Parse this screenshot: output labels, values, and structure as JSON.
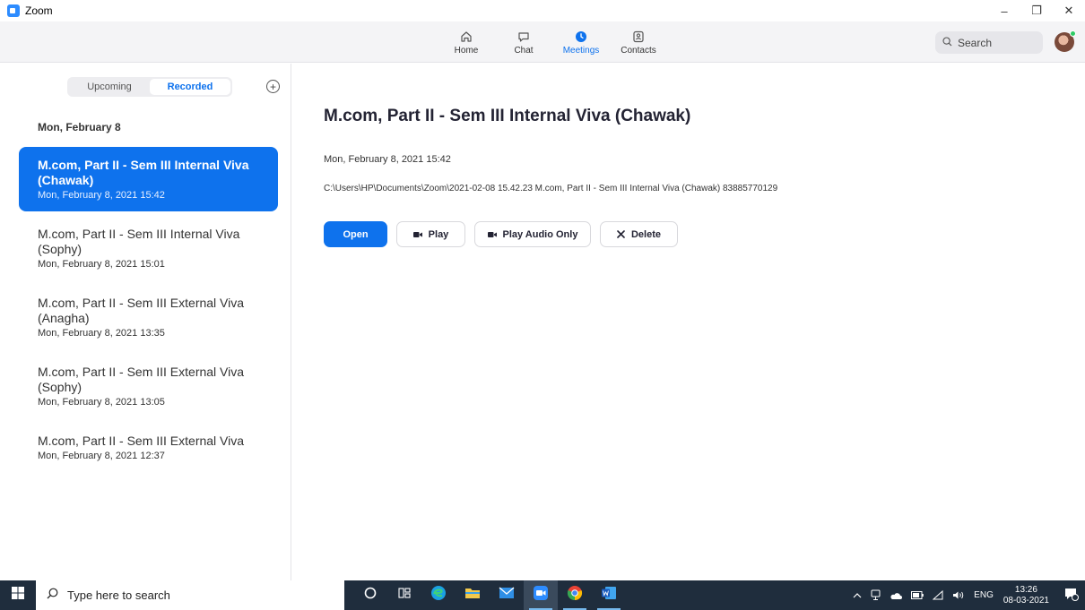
{
  "window": {
    "title": "Zoom",
    "controls": {
      "minimize": "–",
      "restore": "❐",
      "close": "✕"
    }
  },
  "nav": {
    "tabs": [
      {
        "label": "Home",
        "icon": "home-icon"
      },
      {
        "label": "Chat",
        "icon": "chat-icon"
      },
      {
        "label": "Meetings",
        "icon": "clock-icon",
        "active": true
      },
      {
        "label": "Contacts",
        "icon": "contacts-icon"
      }
    ],
    "search_placeholder": "Search"
  },
  "sidebar": {
    "tabs": [
      {
        "label": "Upcoming"
      },
      {
        "label": "Recorded",
        "active": true
      }
    ],
    "date_header": "Mon, February 8",
    "recordings": [
      {
        "title": "M.com, Part II - Sem III Internal Viva (Chawak)",
        "time": "Mon, February 8, 2021 15:42",
        "selected": true
      },
      {
        "title": "M.com, Part II - Sem III Internal Viva (Sophy)",
        "time": "Mon, February 8, 2021 15:01"
      },
      {
        "title": "M.com, Part II - Sem III External Viva (Anagha)",
        "time": "Mon, February 8, 2021 13:35"
      },
      {
        "title": "M.com, Part II - Sem III External Viva (Sophy)",
        "time": "Mon, February 8, 2021 13:05"
      },
      {
        "title": "M.com, Part II - Sem III External Viva",
        "time": "Mon, February 8, 2021 12:37"
      }
    ]
  },
  "detail": {
    "title": "M.com, Part II - Sem III Internal Viva (Chawak)",
    "date": "Mon, February 8, 2021 15:42",
    "path": "C:\\Users\\HP\\Documents\\Zoom\\2021-02-08 15.42.23 M.com, Part II - Sem III Internal Viva (Chawak) 83885770129",
    "buttons": {
      "open": "Open",
      "play": "Play",
      "play_audio": "Play Audio Only",
      "delete": "Delete"
    }
  },
  "taskbar": {
    "search_placeholder": "Type here to search",
    "language": "ENG",
    "time": "13:26",
    "date": "08-03-2021",
    "notification_count": "1"
  },
  "colors": {
    "accent": "#0e72ed",
    "taskbar": "#1f2d3d"
  }
}
